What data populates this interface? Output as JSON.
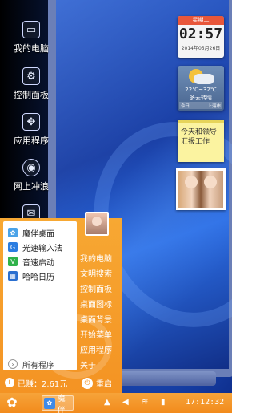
{
  "desktop": {
    "icons": [
      {
        "label": "我的电脑",
        "icon": "computer-icon"
      },
      {
        "label": "控制面板",
        "icon": "control-panel-icon"
      },
      {
        "label": "应用程序",
        "icon": "applications-icon"
      },
      {
        "label": "网上冲浪",
        "icon": "browser-icon"
      },
      {
        "label": "",
        "icon": "mail-icon"
      }
    ]
  },
  "widgets": {
    "clock": {
      "day": "星期二",
      "time": "02:57",
      "date": "2014年05月26日"
    },
    "weather": {
      "temp": "22℃~32℃",
      "condition": "多云转晴",
      "left_label": "今日",
      "right_label": "上海市"
    },
    "note": {
      "text": "今天和领导汇报工作"
    }
  },
  "start_menu": {
    "items": [
      {
        "label": "魔伴桌面",
        "icon": "moban-icon",
        "color": "#4aa3e8"
      },
      {
        "label": "光速输入法",
        "icon": "input-method-icon",
        "color": "#2a7de1"
      },
      {
        "label": "音速启动",
        "icon": "sound-launch-icon",
        "color": "#2fb24a"
      },
      {
        "label": "哈哈日历",
        "icon": "calendar-icon",
        "color": "#2a6fd0"
      }
    ],
    "all_programs": "所有程序",
    "right_links": [
      "我的电脑",
      "文明搜索",
      "控制面板",
      "桌面图标",
      "桌面背景",
      "开始菜单",
      "应用程序",
      "关于"
    ],
    "earned": "已赚：2.61元",
    "restart": "重启"
  },
  "taskbar": {
    "task_label": "魔伴",
    "clock": "17:12:32",
    "accent": "#f49323"
  }
}
